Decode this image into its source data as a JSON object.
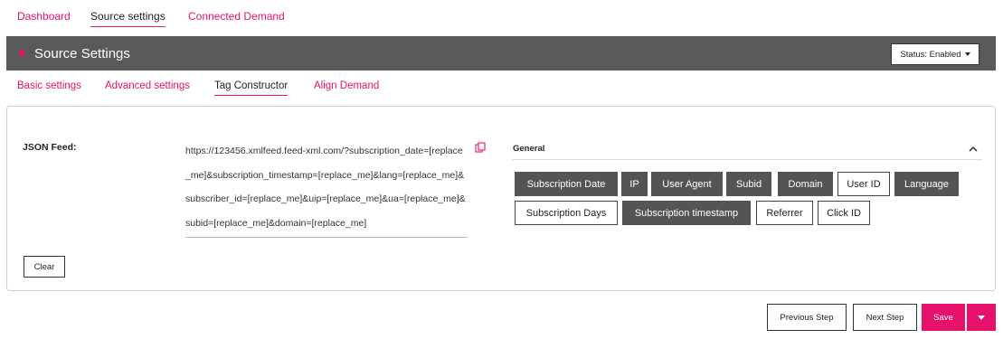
{
  "top_nav": {
    "tabs": [
      {
        "label": "Dashboard",
        "active": false
      },
      {
        "label": "Source settings",
        "active": true
      },
      {
        "label": "Connected Demand",
        "active": false
      }
    ]
  },
  "header": {
    "title": "Source Settings",
    "status_label": "Status: Enabled",
    "accent_color": "#e6116b",
    "bar_color": "#595959"
  },
  "sub_nav": {
    "tabs": [
      {
        "label": "Basic settings",
        "active": false
      },
      {
        "label": "Advanced settings",
        "active": false
      },
      {
        "label": "Tag Constructor",
        "active": true
      },
      {
        "label": "Align Demand",
        "active": false
      }
    ]
  },
  "json_feed": {
    "label": "JSON Feed:",
    "value": "https://123456.xmlfeed.feed-xml.com/?subscription_date=[replace_me]&subscription_timestamp=[replace_me]&lang=[replace_me]&subscriber_id=[replace_me]&uip=[replace_me]&ua=[replace_me]&subid=[replace_me]&domain=[replace_me]",
    "copy_icon": "copy-icon",
    "clear_label": "Clear"
  },
  "general": {
    "label": "General",
    "collapse_icon": "chevron-up-icon",
    "params": [
      {
        "label": "Subscription Date",
        "selected": true
      },
      {
        "label": "IP",
        "selected": true
      },
      {
        "label": "User Agent",
        "selected": true
      },
      {
        "label": "Subid",
        "selected": true
      },
      {
        "label": "Domain",
        "selected": true
      },
      {
        "label": "User ID",
        "selected": false
      },
      {
        "label": "Language",
        "selected": true
      },
      {
        "label": "Subscription Days",
        "selected": false
      },
      {
        "label": "Subscription timestamp",
        "selected": true
      },
      {
        "label": "Referrer",
        "selected": false
      },
      {
        "label": "Click ID",
        "selected": false
      }
    ]
  },
  "footer": {
    "previous_label": "Previous Step",
    "next_label": "Next Step",
    "save_label": "Save"
  }
}
